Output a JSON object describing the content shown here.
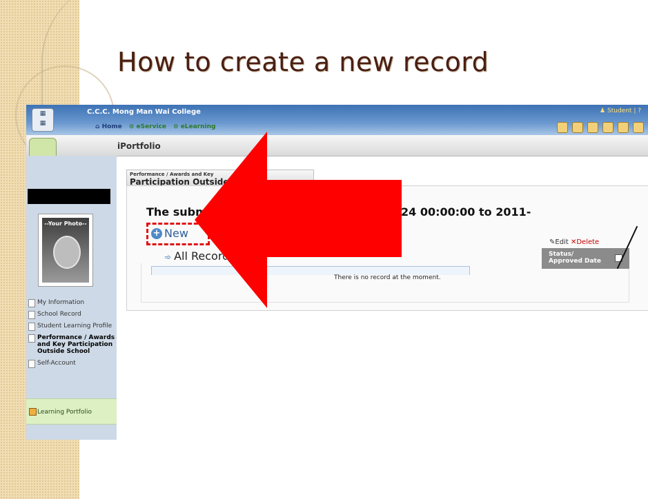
{
  "slide": {
    "title": "How to create a new record"
  },
  "header": {
    "school_name": "C.C.C. Mong Man Wai College",
    "user_link": "Student",
    "help": "?",
    "nav": [
      "Home",
      "eService",
      "eLearning"
    ],
    "app_title": "iPortfolio"
  },
  "sidebar": {
    "photo_placeholder": "--Your Photo--",
    "menu": [
      "My Information",
      "School Record",
      "Student Learning Profile",
      "Performance / Awards and Key Participation Outside School",
      "Self-Account"
    ],
    "learning_portfolio": "Learning Portfolio"
  },
  "main": {
    "tab_small": "Performance / Awards and Key",
    "tab_big": "Participation Outside School",
    "submission_text": "The submissi",
    "period_text": "24 00:00:00 to 2011-",
    "new_label": "New",
    "all_records": "All Records",
    "edit_label": "Edit",
    "delete_label": "Delete",
    "status_header": "Status/ Approved Date",
    "empty_message": "There is no record at the moment."
  },
  "colors": {
    "arrow": "#ff0000",
    "header_blue": "#3d72b4",
    "slide_title": "#4b1e12"
  }
}
